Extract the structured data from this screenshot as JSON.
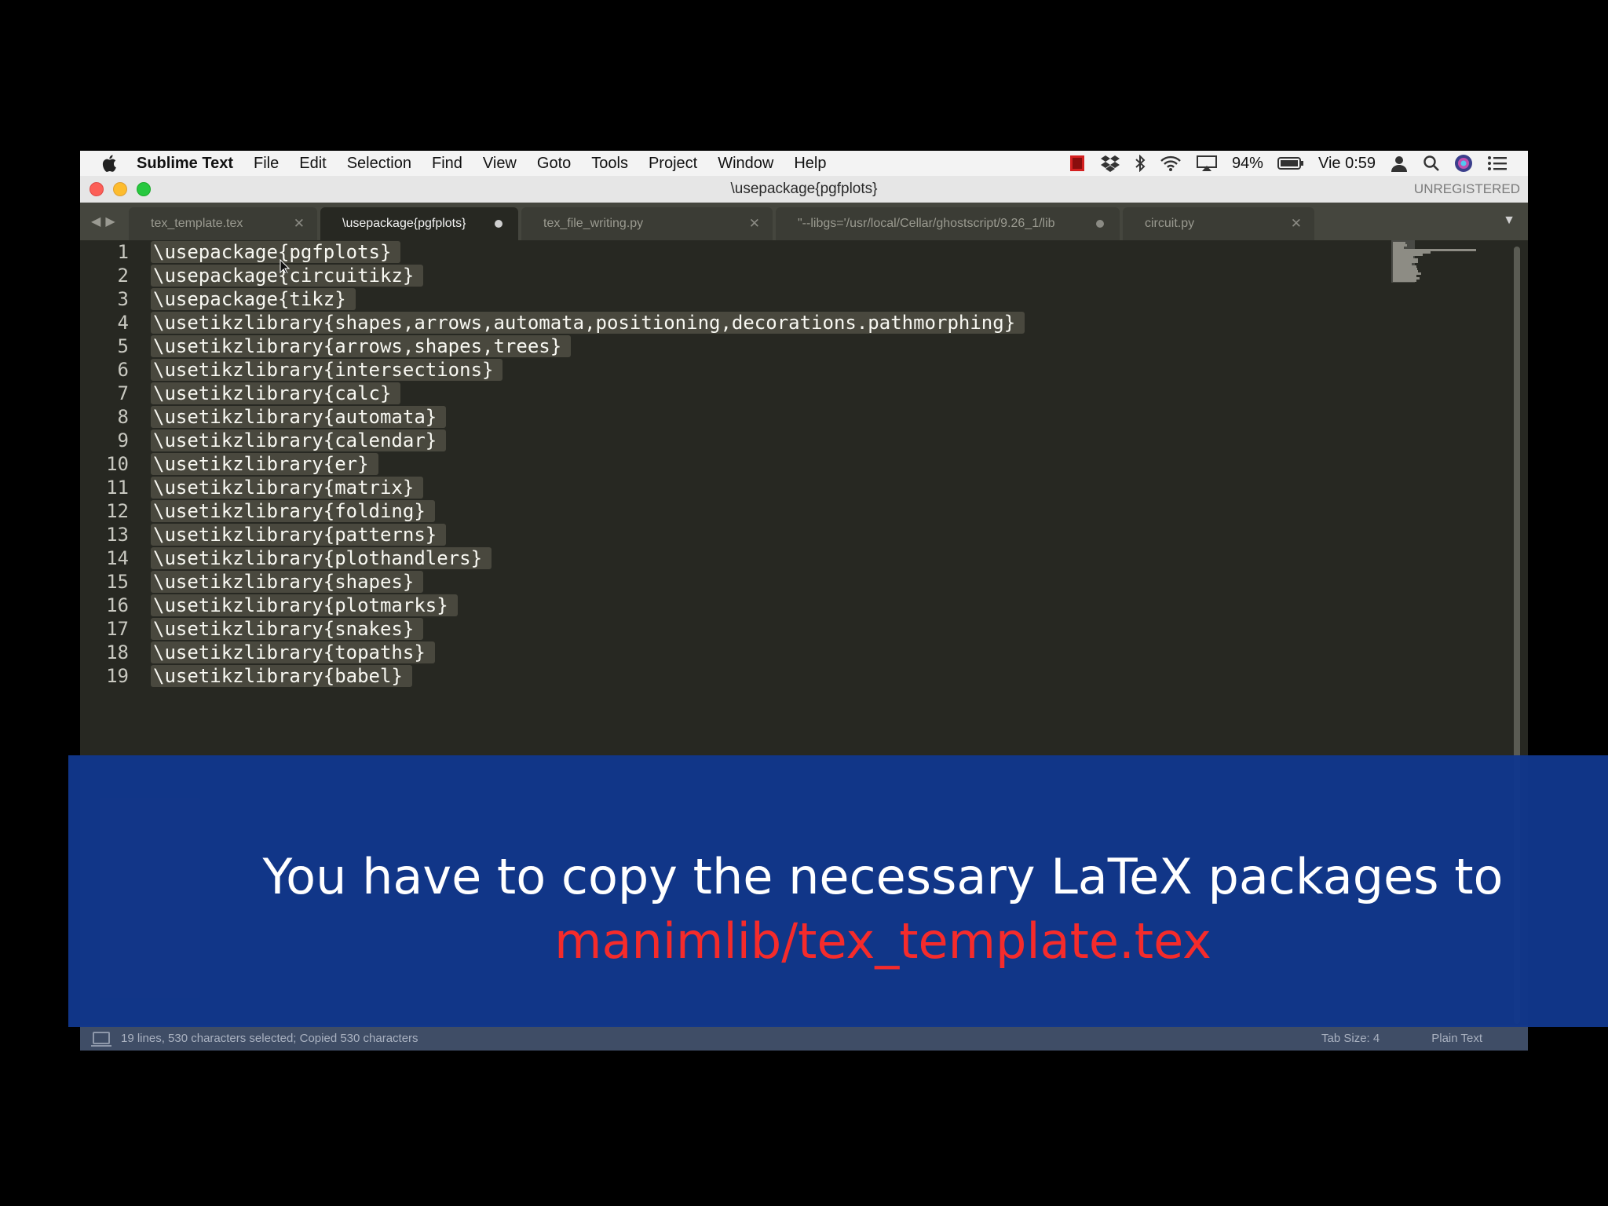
{
  "menubar": {
    "app_name": "Sublime Text",
    "items": [
      "File",
      "Edit",
      "Selection",
      "Find",
      "View",
      "Goto",
      "Tools",
      "Project",
      "Window",
      "Help"
    ],
    "battery": "94%",
    "clock": "Vie 0:59"
  },
  "window": {
    "title": "\\usepackage{pgfplots}",
    "registration": "UNREGISTERED"
  },
  "tabs": [
    {
      "label": "tex_template.tex",
      "state": "close"
    },
    {
      "label": "\\usepackage{pgfplots}",
      "state": "dirty",
      "active": true
    },
    {
      "label": "tex_file_writing.py",
      "state": "close"
    },
    {
      "label": "\"--libgs='/usr/local/Cellar/ghostscript/9.26_1/lib",
      "state": "dirty"
    },
    {
      "label": "circuit.py",
      "state": "close"
    }
  ],
  "editor": {
    "line_numbers": [
      "1",
      "2",
      "3",
      "4",
      "5",
      "6",
      "7",
      "8",
      "9",
      "10",
      "11",
      "12",
      "13",
      "14",
      "15",
      "16",
      "17",
      "18",
      "19"
    ],
    "lines": [
      "\\usepackage{pgfplots}",
      "\\usepackage{circuitikz}",
      "\\usepackage{tikz}",
      "\\usetikzlibrary{shapes,arrows,automata,positioning,decorations.pathmorphing}",
      "\\usetikzlibrary{arrows,shapes,trees}",
      "\\usetikzlibrary{intersections}",
      "\\usetikzlibrary{calc}",
      "\\usetikzlibrary{automata}",
      "\\usetikzlibrary{calendar}",
      "\\usetikzlibrary{er}",
      "\\usetikzlibrary{matrix}",
      "\\usetikzlibrary{folding}",
      "\\usetikzlibrary{patterns}",
      "\\usetikzlibrary{plothandlers}",
      "\\usetikzlibrary{shapes}",
      "\\usetikzlibrary{plotmarks}",
      "\\usetikzlibrary{snakes}",
      "\\usetikzlibrary{topaths}",
      "\\usetikzlibrary{babel}"
    ]
  },
  "statusbar": {
    "message": "19 lines, 530 characters selected; Copied 530 characters",
    "tab_size": "Tab Size: 4",
    "syntax": "Plain Text"
  },
  "caption": {
    "line1": "You have to copy the necessary LaTeX packages to",
    "line2": "manimlib/tex_template.tex"
  },
  "colors": {
    "editor_bg": "#272822",
    "selection": "#49483e",
    "caption_bg": "#11378c",
    "caption_highlight": "#f52b2b"
  }
}
